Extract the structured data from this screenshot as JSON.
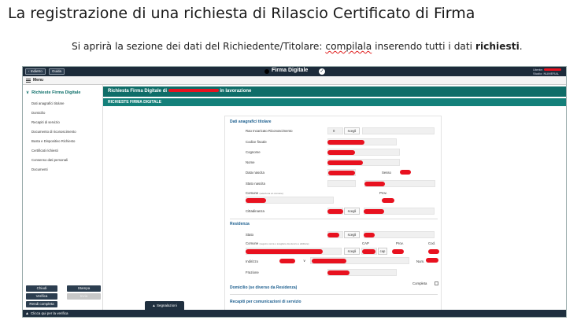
{
  "slide": {
    "title": "La registrazione di una richiesta di Rilascio Certificato di Firma",
    "subtitle_before": "Si aprirà la sezione dei dati del Richiedente/Titolare: ",
    "subtitle_wavy": "compilala",
    "subtitle_middle": " inserendo tutti i dati ",
    "subtitle_bold": "richiesti",
    "subtitle_after": "."
  },
  "app": {
    "back_label": "‹  Indietro",
    "guide_label": "Guida",
    "brand": "Firma Digitale",
    "brand_check": "✓",
    "user_label": "Utente:",
    "studio_label": "Studio: NUMERAL",
    "menu_label": "Menu",
    "colors": {
      "topbar": "#1c2b3a",
      "teal": "#0f6d68",
      "teal2": "#14807a",
      "redact": "#e8111f",
      "section_blue": "#1d5f8f"
    }
  },
  "sidebar": {
    "header": "Richieste Firma Digitale",
    "chevron": "∨",
    "items": [
      "Dati anagrafici titolare",
      "Domicilio",
      "Recapiti di servizio",
      "Documento di riconoscimento",
      "Busta e Dispositivo Richiesto",
      "Certificati richiesti",
      "Consenso dati personali",
      "Documenti"
    ],
    "buttons": {
      "chiudi": "Chiudi",
      "stampa": "Stampa",
      "verifica": "Verifica",
      "invia": "Invia",
      "rendi_completa": "Rendi completa"
    }
  },
  "header": {
    "title_prefix": "Richiesta Firma Digitale di",
    "title_suffix": "in lavorazione",
    "subbar": "RICHIESTE FIRMA DIGITALE"
  },
  "form": {
    "section_titolare": "Dati anagrafici titolare",
    "rao_label": "Rao Incaricato Riconoscimento",
    "rao_value": "0",
    "scegli": "scegli",
    "codice_fiscale": "Codice fiscale",
    "cognome": "Cognome",
    "nome": "Nome",
    "data_nascita": "Data nascita",
    "sesso": "Sesso",
    "stato_nascita": "Stato nascita",
    "comune_label": "Comune",
    "comune_hint": "(seleziona un comune)",
    "prov": "Prov.",
    "cittadinanza": "Cittadinanza",
    "section_residenza": "Residenza",
    "stato": "Stato",
    "comune_res_hint": "(seguire cerca o scegliere da elenco e abilitare)",
    "cap": "CAP",
    "cod": "Cod.",
    "cap_button": "cap",
    "indirizzo": "Indirizzo",
    "num": "Num.",
    "frazione": "Frazione",
    "completa": "Completa",
    "section_domicilio": "Domicilio (se diverso da Residenza)",
    "section_recapiti": "Recapiti per comunicazioni di servizio"
  },
  "footer": {
    "segnalazioni": "Segnalazioni",
    "verifica_hint": "Clicca qui per la verifica",
    "segnalazioni_icon": "▲",
    "verifica_icon": "▲"
  }
}
